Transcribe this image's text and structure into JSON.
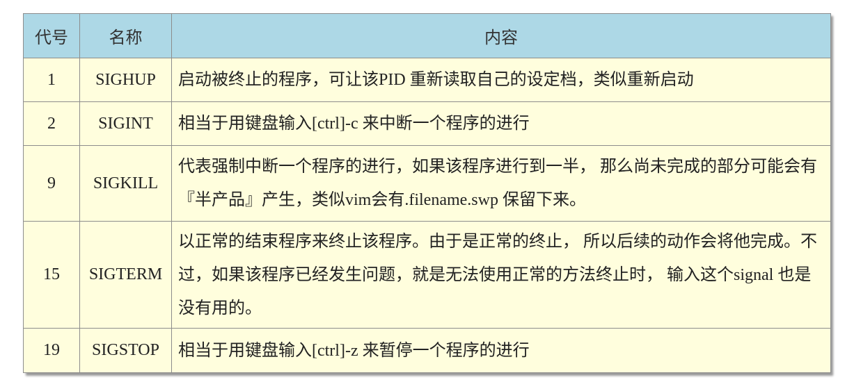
{
  "table": {
    "headers": {
      "code": "代号",
      "name": "名称",
      "content": "内容"
    },
    "rows": [
      {
        "code": "1",
        "name": "SIGHUP",
        "content": "启动被终止的程序，可让该PID 重新读取自己的设定档，类似重新启动"
      },
      {
        "code": "2",
        "name": "SIGINT",
        "content": "相当于用键盘输入[ctrl]-c 来中断一个程序的进行"
      },
      {
        "code": "9",
        "name": "SIGKILL",
        "content": "代表强制中断一个程序的进行，如果该程序进行到一半， 那么尚未完成的部分可能会有『半产品』产生，类似vim会有.filename.swp 保留下来。"
      },
      {
        "code": "15",
        "name": "SIGTERM",
        "content": "以正常的结束程序来终止该程序。由于是正常的终止， 所以后续的动作会将他完成。不过，如果该程序已经发生问题，就是无法使用正常的方法终止时， 输入这个signal 也是没有用的。"
      },
      {
        "code": "19",
        "name": "SIGSTOP",
        "content": "相当于用键盘输入[ctrl]-z 来暂停一个程序的进行"
      }
    ]
  }
}
